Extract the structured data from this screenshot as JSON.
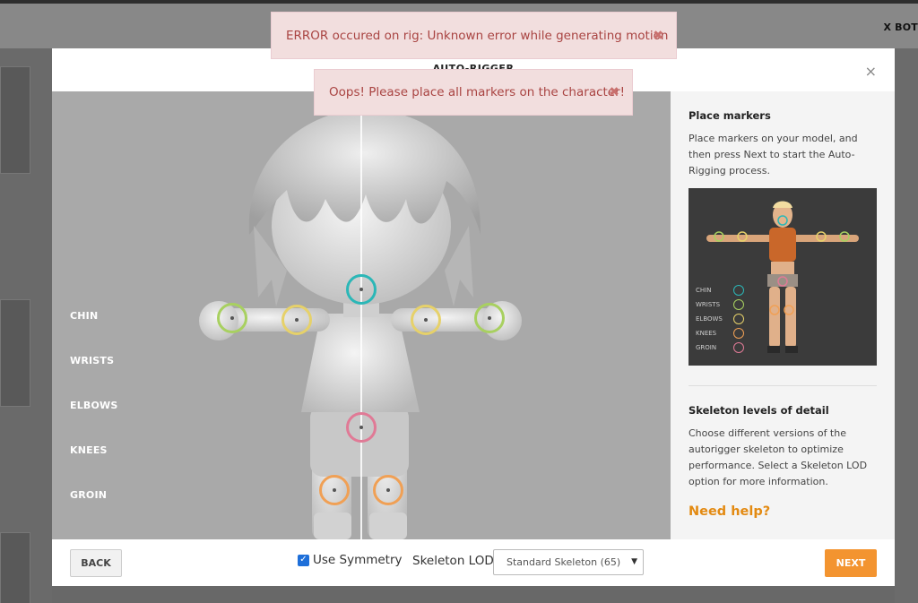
{
  "background": {
    "top_right_title": "X BOT"
  },
  "modal": {
    "title": "AUTO-RIGGER",
    "close_glyph": "×"
  },
  "viewport": {
    "legend": [
      "CHIN",
      "WRISTS",
      "ELBOWS",
      "KNEES",
      "GROIN"
    ]
  },
  "side_panel": {
    "place_markers_heading": "Place markers",
    "place_markers_text": "Place markers on your model, and then press Next to start the Auto-Rigging process.",
    "reference_legend": [
      "CHIN",
      "WRISTS",
      "ELBOWS",
      "KNEES",
      "GROIN"
    ],
    "lod_heading": "Skeleton levels of detail",
    "lod_text": "Choose different versions of the autorigger skeleton to optimize performance. Select a Skeleton LOD option for more information.",
    "help_link": "Need help?"
  },
  "footer": {
    "back_label": "BACK",
    "symmetry_label": "Use Symmetry",
    "symmetry_checked": true,
    "lod_label": "Skeleton LOD",
    "lod_selected": "Standard Skeleton (65)",
    "next_label": "NEXT"
  },
  "toasts": {
    "error_rig": "ERROR occured on rig: Unknown error while generating motion",
    "error_markers": "Oops! Please place all markers on the character!",
    "close_glyph": "✖"
  },
  "colors": {
    "chin": "#2bb7b7",
    "wrists": "#a8d060",
    "elbows": "#e6d16a",
    "knees": "#f0a055",
    "groin": "#e07a96",
    "accent": "#f39430",
    "link": "#e38a12"
  },
  "icons": {
    "modal_close": "close-icon",
    "toast_close": "close-icon",
    "checkbox": "check-icon",
    "select": "chevron-down-icon"
  }
}
